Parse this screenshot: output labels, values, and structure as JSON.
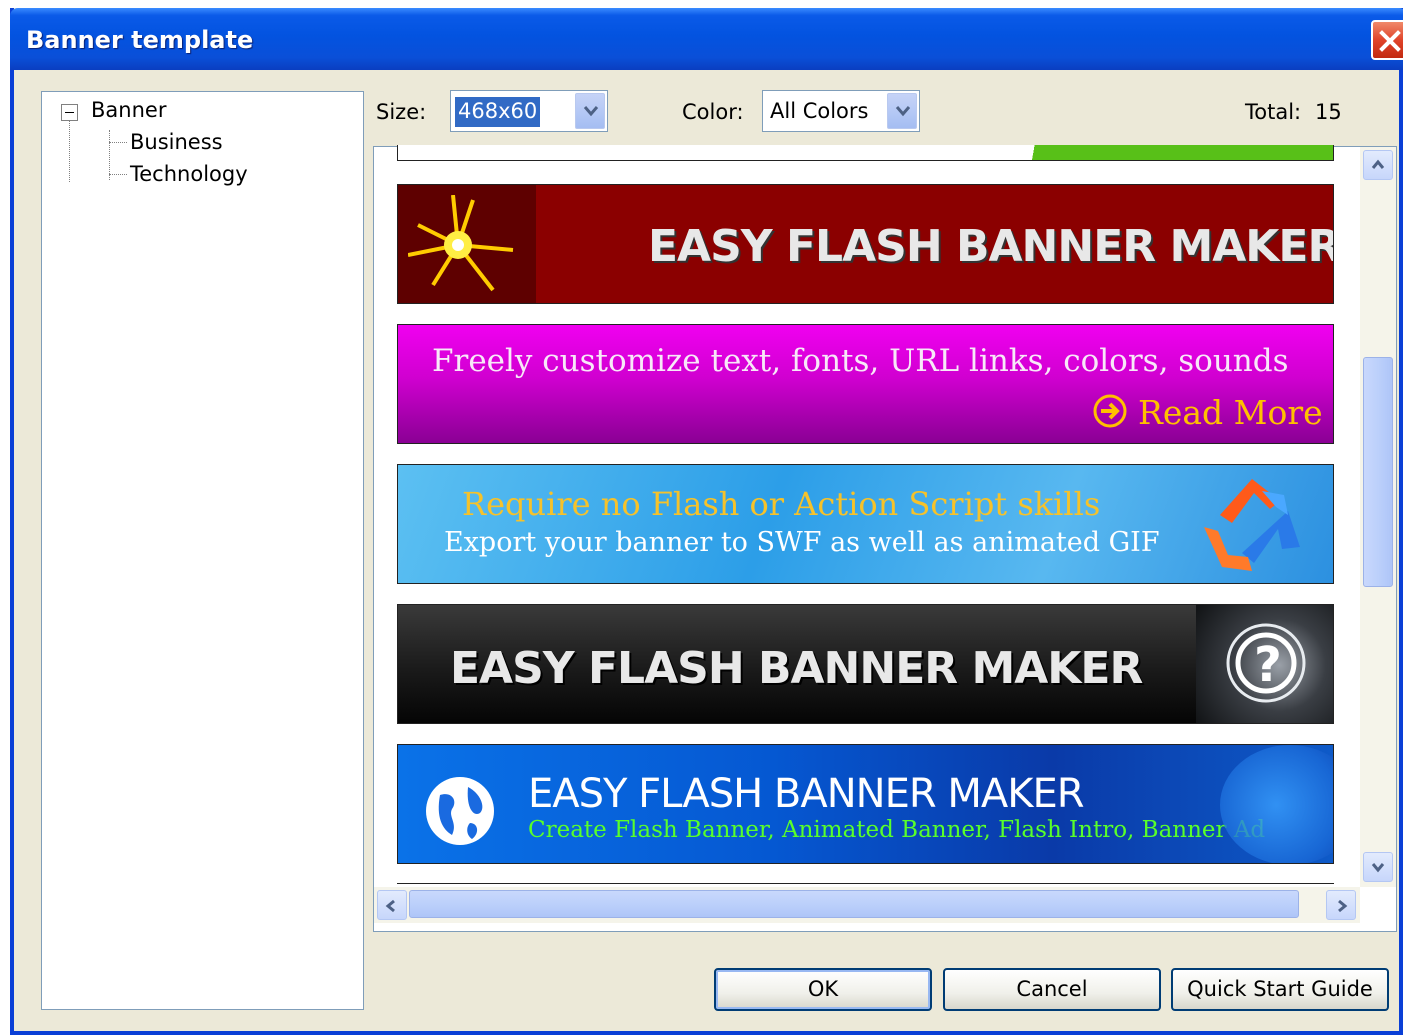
{
  "window": {
    "title": "Banner template"
  },
  "tree": {
    "root": "Banner",
    "children": [
      "Business",
      "Technology"
    ]
  },
  "filters": {
    "size_label": "Size:",
    "size_value": "468x60",
    "color_label": "Color:",
    "color_value": "All Colors",
    "total_label": "Total:",
    "total_value": "15"
  },
  "banners": [
    {
      "id": "red",
      "text1": "EASY FLASH BANNER MAKER",
      "colors": {
        "bg": "#8b0000",
        "panel": "#5e0000",
        "text": "#e8e8e8"
      }
    },
    {
      "id": "magenta",
      "text1": "Freely customize text, fonts, URL links, colors, sounds",
      "text2": "Read More",
      "colors": {
        "bg": "#d400d4",
        "text2": "#ffc000"
      }
    },
    {
      "id": "blue-recycle",
      "text1": "Require no Flash or Action Script skills",
      "text2": "Export your banner to SWF as well as animated GIF",
      "colors": {
        "bg": "#3aa0e8",
        "text1": "#f6c22a"
      }
    },
    {
      "id": "black",
      "text1": "EASY FLASH BANNER MAKER",
      "colors": {
        "bg": "#1c1c1c"
      }
    },
    {
      "id": "blue-globe",
      "text1": "EASY FLASH BANNER MAKER",
      "text2": "Create Flash Banner, Animated Banner, Flash Intro, Banner Ad",
      "colors": {
        "bg": "#0a5ad8",
        "text2": "#59ff2a"
      }
    }
  ],
  "buttons": {
    "ok": "OK",
    "cancel": "Cancel",
    "guide": "Quick Start Guide"
  },
  "icons": [
    "close-icon",
    "collapse-icon",
    "dropdown-arrow-icon",
    "scroll-up-icon",
    "scroll-down-icon",
    "scroll-left-icon",
    "scroll-right-icon",
    "starburst-icon",
    "arrow-circle-icon",
    "recycle-icon",
    "question-mark-icon",
    "globe-icon"
  ]
}
